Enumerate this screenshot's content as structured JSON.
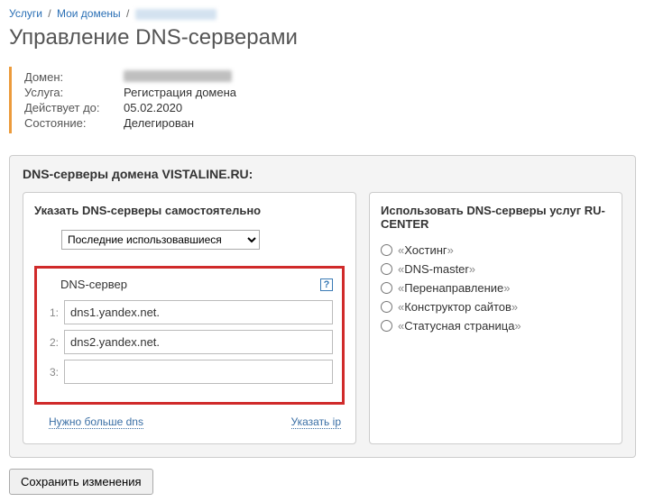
{
  "breadcrumb": {
    "item0": "Услуги",
    "item1": "Мои домены"
  },
  "page_title": "Управление DNS-серверами",
  "info": {
    "domain_label": "Домен:",
    "service_label": "Услуга:",
    "service_value": "Регистрация домена",
    "valid_label": "Действует до:",
    "valid_value": "05.02.2020",
    "state_label": "Состояние:",
    "state_value": "Делегирован"
  },
  "panel": {
    "title": "DNS-серверы домена VISTALINE.RU:"
  },
  "left": {
    "title": "Указать DNS-серверы самостоятельно",
    "recent_label": "Последние использовавшиеся",
    "dns_header": "DNS-сервер",
    "rows": [
      {
        "n": "1:",
        "v": "dns1.yandex.net."
      },
      {
        "n": "2:",
        "v": "dns2.yandex.net."
      },
      {
        "n": "3:",
        "v": ""
      }
    ],
    "more_dns": "Нужно больше dns",
    "set_ip": "Указать ip"
  },
  "right": {
    "title": "Использовать DNS-серверы услуг RU-CENTER",
    "options": [
      "Хостинг",
      "DNS-master",
      "Перенаправление",
      "Конструктор сайтов",
      "Статусная страница"
    ]
  },
  "save_label": "Сохранить изменения"
}
